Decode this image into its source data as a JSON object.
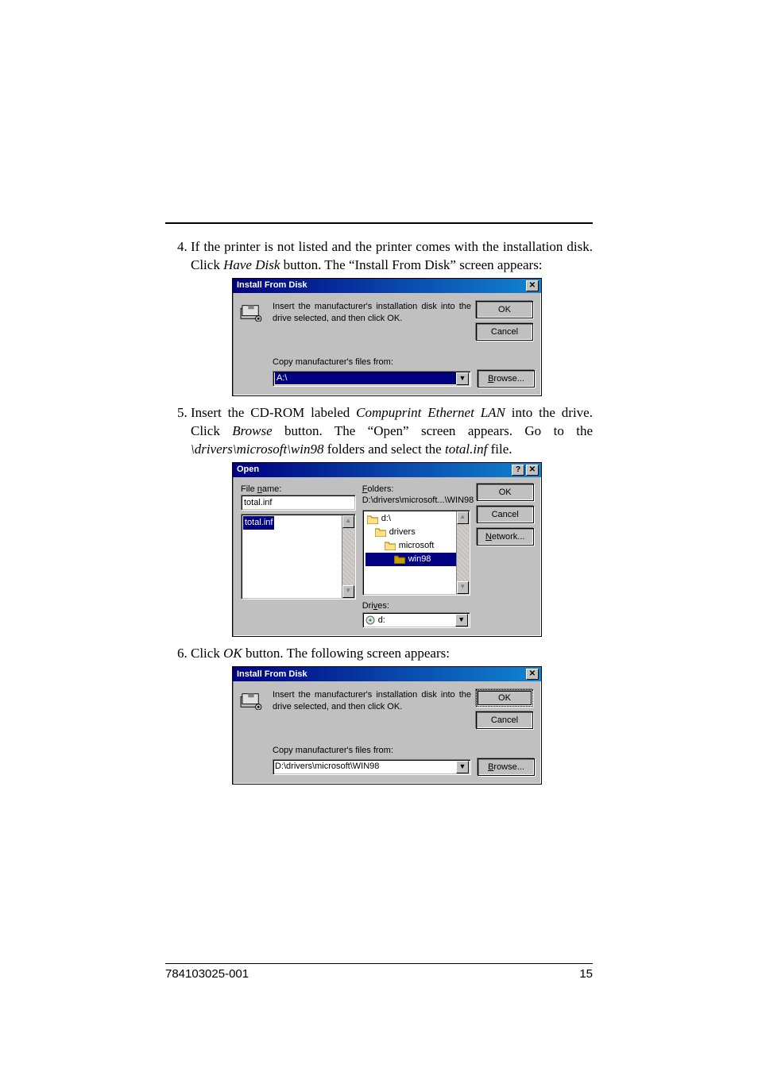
{
  "steps": {
    "s4_a": "If the printer is not listed and the printer comes with the installation disk. Click ",
    "s4_b": "Have Disk",
    "s4_c": " button. The “Install From Disk” screen appears:",
    "s5_a": "Insert the CD-ROM labeled ",
    "s5_b": "Compuprint Ethernet LAN",
    "s5_c": " into the drive. Click ",
    "s5_d": "Browse",
    "s5_e": " button. The “Open” screen appears. Go to the ",
    "s5_f": "\\drivers\\microsoft\\win98",
    "s5_g": " folders and select the ",
    "s5_h": "total.inf",
    "s5_i": " file.",
    "s6_a": "Click ",
    "s6_b": "OK",
    "s6_c": " button. The following screen appears:"
  },
  "dlg1": {
    "title": "Install From Disk",
    "close": "✕",
    "msg": "Insert the manufacturer's installation disk into the drive selected, and then click OK.",
    "ok": "OK",
    "cancel": "Cancel",
    "copy_label": "Copy manufacturer's files from:",
    "path": "A:\\",
    "browse_pre": "B",
    "browse_rest": "rowse..."
  },
  "open": {
    "title": "Open",
    "help": "?",
    "close": "✕",
    "filename_u": "n",
    "filename_pre": "File ",
    "filename_post": "ame:",
    "filename_value": "total.inf",
    "file_sel": "total.inf",
    "folders_u": "F",
    "folders_rest": "olders:",
    "folders_path": "D:\\drivers\\microsoft...\\WIN98",
    "tree": {
      "d": "d:\\",
      "drivers": "drivers",
      "microsoft": "microsoft",
      "win98": "win98"
    },
    "drives_pre": "Dri",
    "drives_u": "v",
    "drives_post": "es:",
    "drive_sel": "d:",
    "ok": "OK",
    "cancel": "Cancel",
    "network_u": "N",
    "network_rest": "etwork..."
  },
  "dlg3": {
    "title": "Install From Disk",
    "close": "✕",
    "msg": "Insert the manufacturer's installation disk into the drive selected, and then click OK.",
    "ok": "OK",
    "cancel": "Cancel",
    "copy_label": "Copy manufacturer's files from:",
    "path": "D:\\drivers\\microsoft\\WIN98",
    "browse_pre": "B",
    "browse_rest": "rowse..."
  },
  "footer": {
    "left": "784103025-001",
    "right": "15"
  }
}
